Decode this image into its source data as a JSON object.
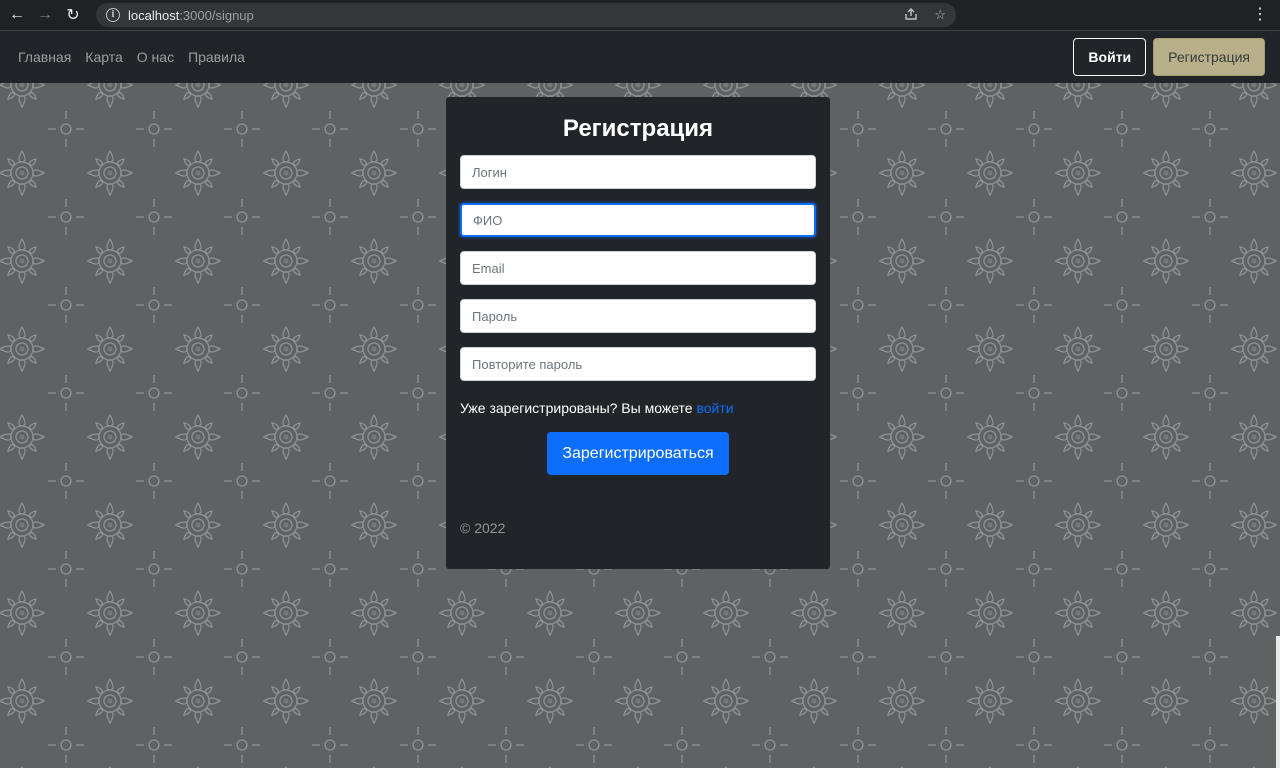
{
  "browser": {
    "url_host": "localhost",
    "url_path": ":3000/signup"
  },
  "navbar": {
    "links": [
      "Главная",
      "Карта",
      "О нас",
      "Правила"
    ],
    "login_label": "Войти",
    "register_label": "Регистрация"
  },
  "form": {
    "title": "Регистрация",
    "fields": {
      "login_placeholder": "Логин",
      "fio_placeholder": "ФИО",
      "email_placeholder": "Email",
      "password_placeholder": "Пароль",
      "password_repeat_placeholder": "Повторите пароль"
    },
    "already_text": "Уже зарегистрированы? Вы можете ",
    "login_link": "войти",
    "submit_label": "Зарегистрироваться",
    "copyright": "© 2022"
  },
  "colors": {
    "accent": "#0d6efd",
    "navbar_bg": "#212529",
    "register_button": "#b7b08a",
    "background_pattern": "#5f6262"
  },
  "icons": {
    "back": "arrow-left-icon",
    "forward": "arrow-right-icon",
    "reload": "reload-icon",
    "site_info": "info-icon",
    "share": "share-icon",
    "bookmark": "star-icon",
    "menu": "kebab-menu-icon"
  }
}
